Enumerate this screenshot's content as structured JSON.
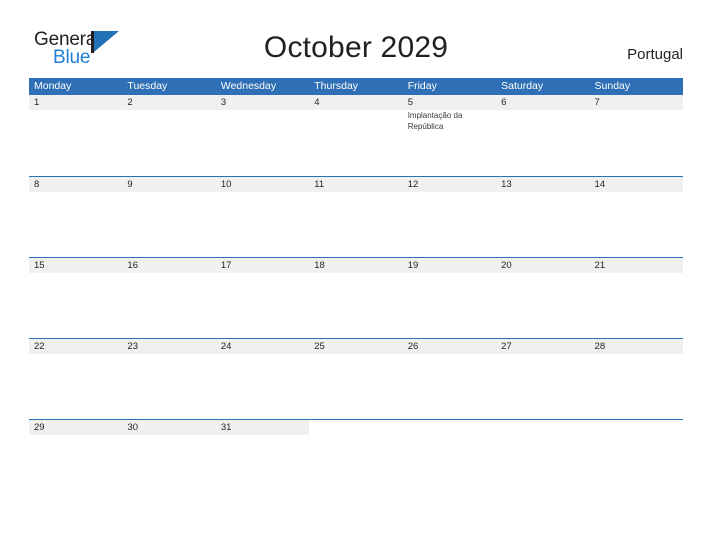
{
  "brand": {
    "name_part1": "General",
    "name_part2": "Blue"
  },
  "header": {
    "title": "October 2029",
    "country": "Portugal"
  },
  "calendar": {
    "weekdays": [
      "Monday",
      "Tuesday",
      "Wednesday",
      "Thursday",
      "Friday",
      "Saturday",
      "Sunday"
    ],
    "accent_color": "#2f6fb5",
    "band_color": "#f0f0f0",
    "weeks": [
      [
        {
          "date": "1",
          "event": ""
        },
        {
          "date": "2",
          "event": ""
        },
        {
          "date": "3",
          "event": ""
        },
        {
          "date": "4",
          "event": ""
        },
        {
          "date": "5",
          "event": "Implantação da República"
        },
        {
          "date": "6",
          "event": ""
        },
        {
          "date": "7",
          "event": ""
        }
      ],
      [
        {
          "date": "8",
          "event": ""
        },
        {
          "date": "9",
          "event": ""
        },
        {
          "date": "10",
          "event": ""
        },
        {
          "date": "11",
          "event": ""
        },
        {
          "date": "12",
          "event": ""
        },
        {
          "date": "13",
          "event": ""
        },
        {
          "date": "14",
          "event": ""
        }
      ],
      [
        {
          "date": "15",
          "event": ""
        },
        {
          "date": "16",
          "event": ""
        },
        {
          "date": "17",
          "event": ""
        },
        {
          "date": "18",
          "event": ""
        },
        {
          "date": "19",
          "event": ""
        },
        {
          "date": "20",
          "event": ""
        },
        {
          "date": "21",
          "event": ""
        }
      ],
      [
        {
          "date": "22",
          "event": ""
        },
        {
          "date": "23",
          "event": ""
        },
        {
          "date": "24",
          "event": ""
        },
        {
          "date": "25",
          "event": ""
        },
        {
          "date": "26",
          "event": ""
        },
        {
          "date": "27",
          "event": ""
        },
        {
          "date": "28",
          "event": ""
        }
      ],
      [
        {
          "date": "29",
          "event": ""
        },
        {
          "date": "30",
          "event": ""
        },
        {
          "date": "31",
          "event": ""
        },
        {
          "date": "",
          "event": ""
        },
        {
          "date": "",
          "event": ""
        },
        {
          "date": "",
          "event": ""
        },
        {
          "date": "",
          "event": ""
        }
      ]
    ]
  }
}
